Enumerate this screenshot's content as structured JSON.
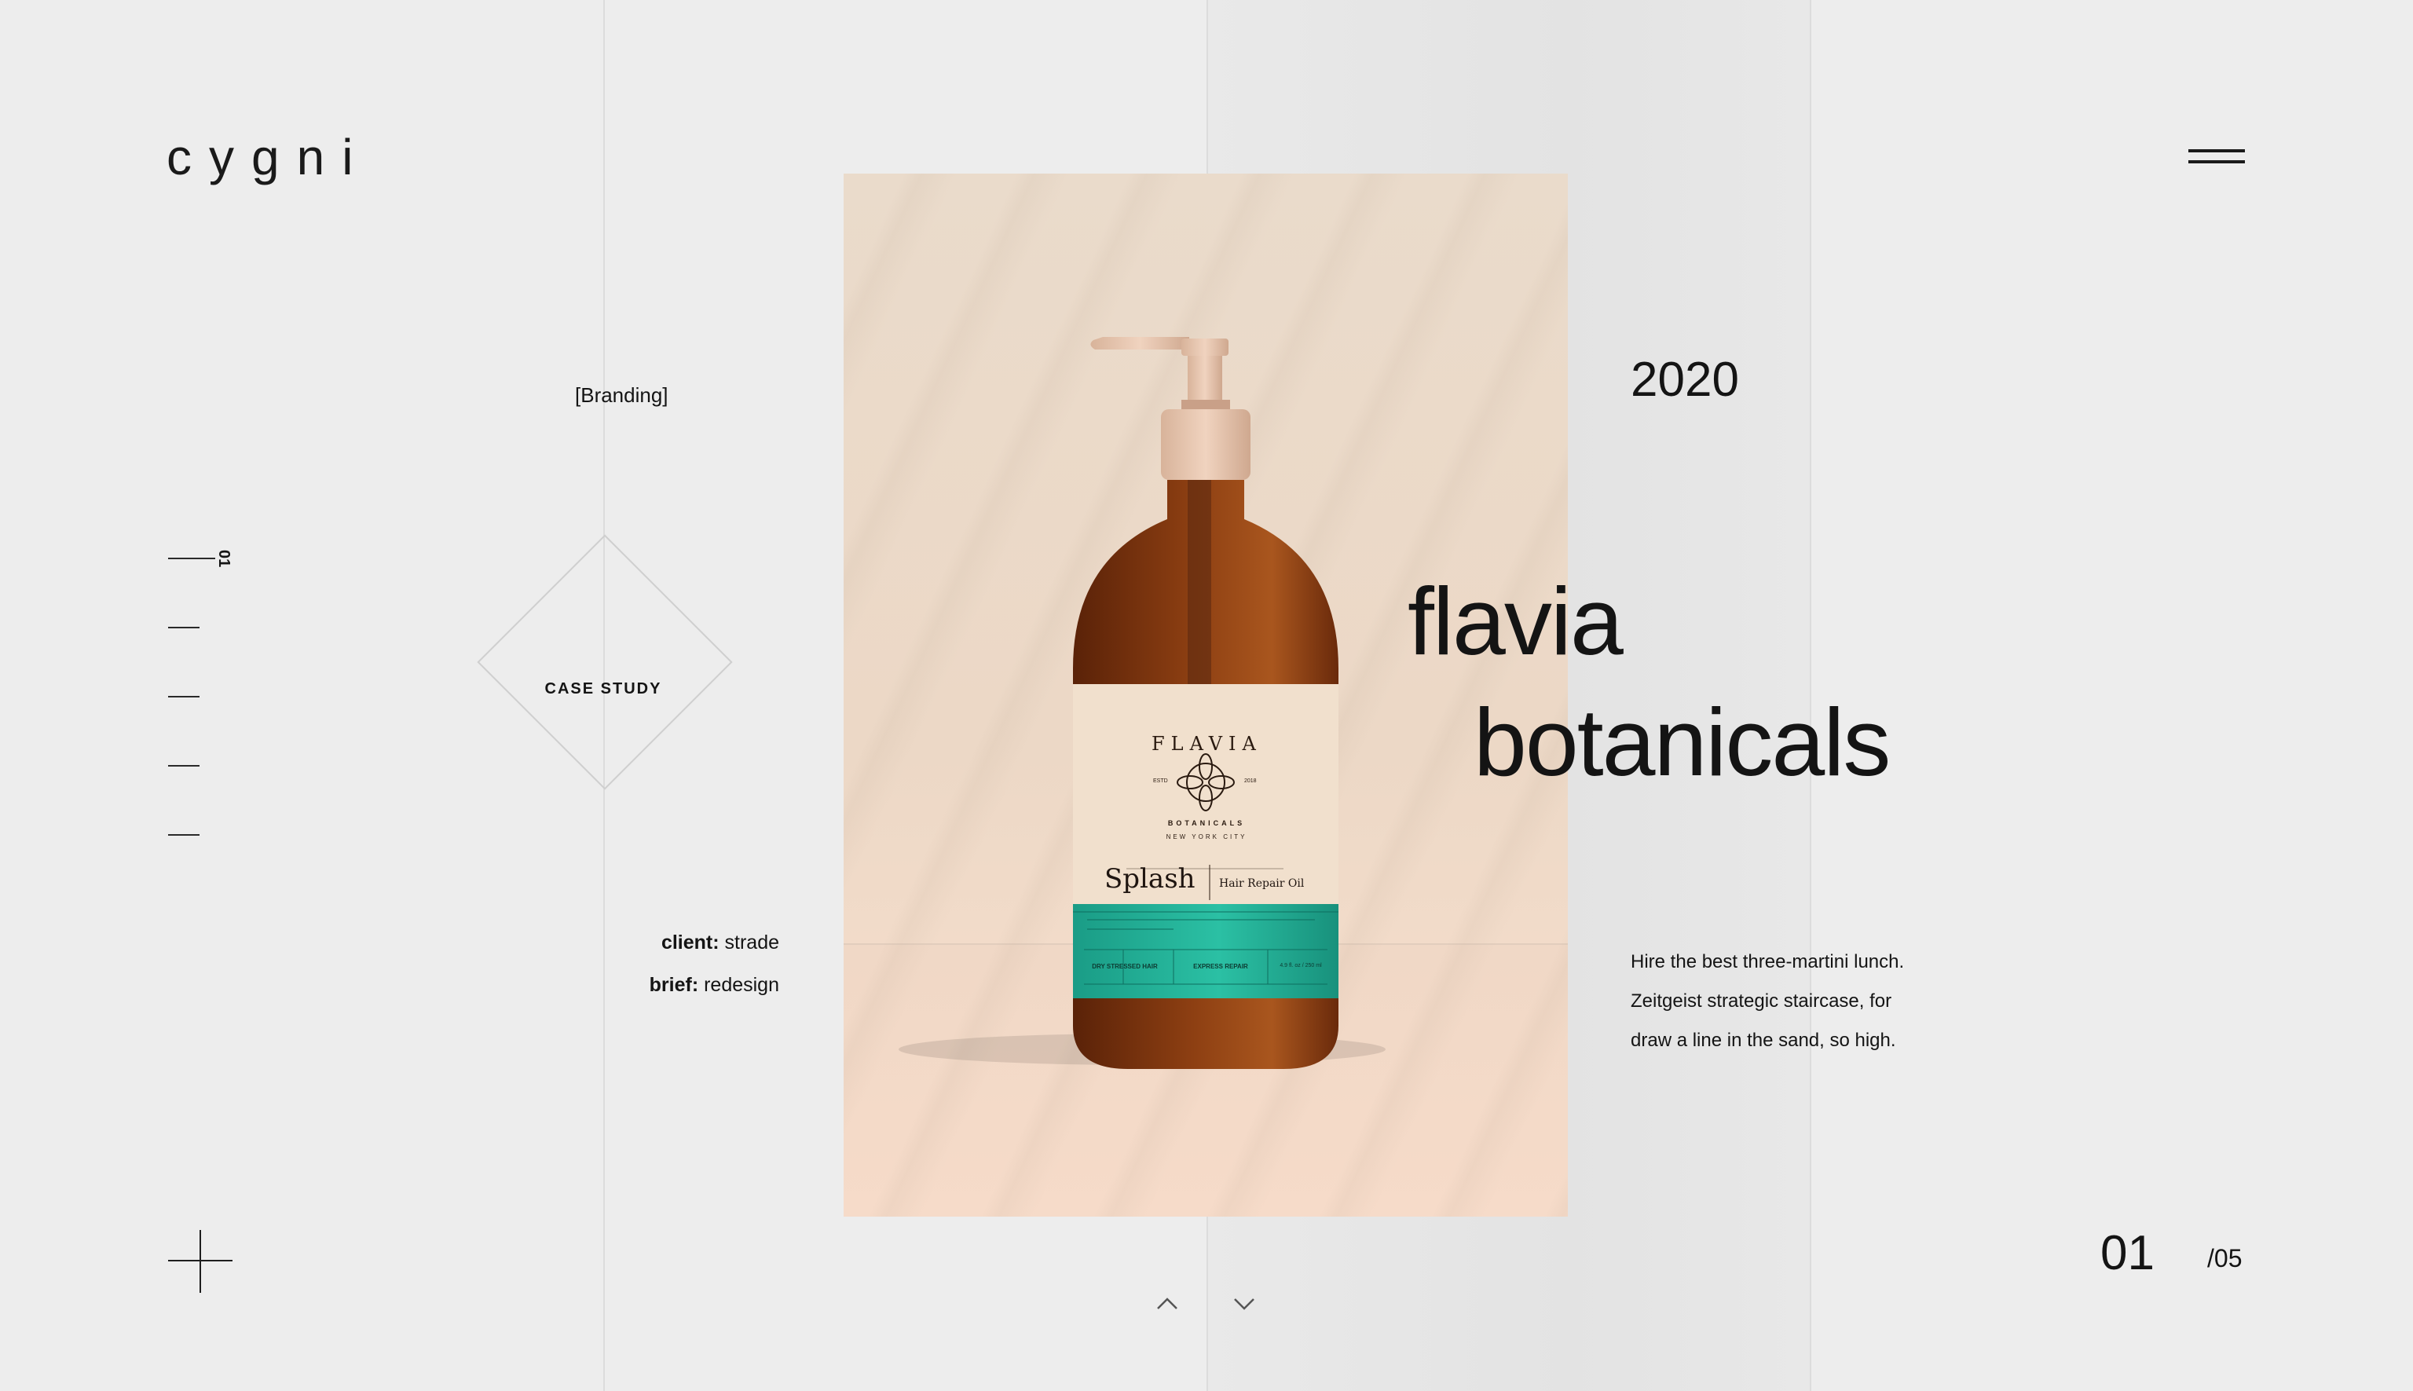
{
  "brand": {
    "logo": "cygni"
  },
  "menu": {
    "icon": "hamburger-menu-icon"
  },
  "side_nav": {
    "active_index": "01",
    "count": 5
  },
  "project": {
    "category": "[Branding]",
    "badge": "CASE STUDY",
    "client_label": "client:",
    "client_value": "strade",
    "brief_label": "brief:",
    "brief_value": "redesign",
    "year": "2020",
    "title_line1": "flavia",
    "title_line2": "botanicals",
    "description_lines": [
      "Hire the best three-martini lunch.",
      "Zeitgeist strategic staircase, for",
      "draw a line in the sand, so high."
    ]
  },
  "product_label": {
    "brand_arc": "FLAVIA",
    "sub_arc": "BOTANICALS",
    "city": "NEW YORK CITY",
    "estd": "ESTD",
    "estd_year": "2018",
    "product_name": "Splash",
    "product_type": "Hair Repair Oil",
    "feature_1": "DRY STRESSED HAIR",
    "feature_2": "EXPRESS REPAIR",
    "volume": "4.9 fl. oz / 250 ml"
  },
  "pagination": {
    "current": "01",
    "total": "/05"
  },
  "colors": {
    "background": "#ededed",
    "text": "#141414",
    "teal": "#1faf95",
    "amber": "#8a3d12",
    "cream": "#f1e0cd"
  }
}
